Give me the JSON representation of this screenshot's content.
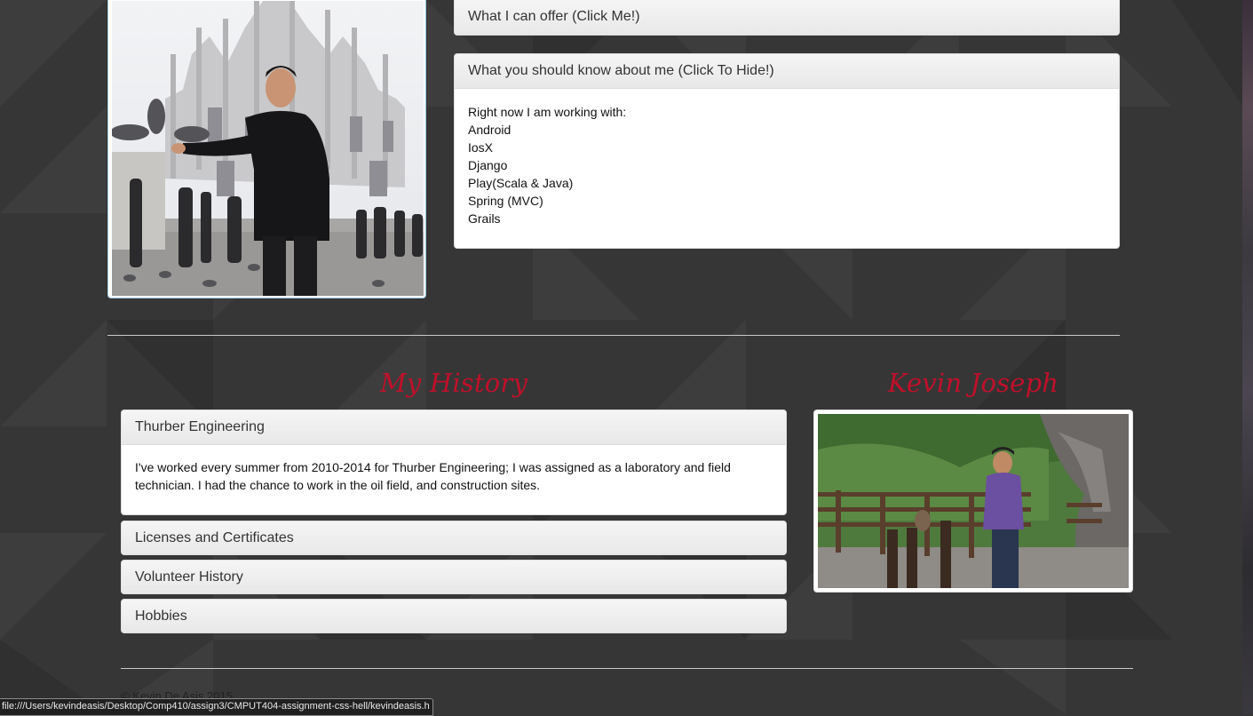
{
  "offer_panel": {
    "title": "What I can offer (Click Me!)"
  },
  "about_panel": {
    "title": "What you should know about me (Click To Hide!)",
    "intro": "Right now I am working with:",
    "items": [
      "Android",
      "IosX",
      "Django",
      "Play(Scala & Java)",
      "Spring (MVC)",
      "Grails"
    ]
  },
  "history": {
    "heading": "My History",
    "panels": [
      {
        "title": "Thurber Engineering",
        "body": "I've worked every summer from 2010-2014 for Thurber Engineering; I was assigned as a laboratory and field technician. I had the chance to work in the oil field, and construction sites."
      },
      {
        "title": "Licenses and Certificates"
      },
      {
        "title": "Volunteer History"
      },
      {
        "title": "Hobbies"
      }
    ]
  },
  "profile": {
    "name": "Kevin Joseph"
  },
  "footer": {
    "copyright": "© Kevin De Asis 2015"
  },
  "status_bar": {
    "url": "file:///Users/kevindeasis/Desktop/Comp410/assign3/CMPUT404-assignment-css-hell/kevindeasis.h"
  },
  "colors": {
    "background": "#363636",
    "heading_red": "#c0102a",
    "panel_header": "#efefef"
  }
}
